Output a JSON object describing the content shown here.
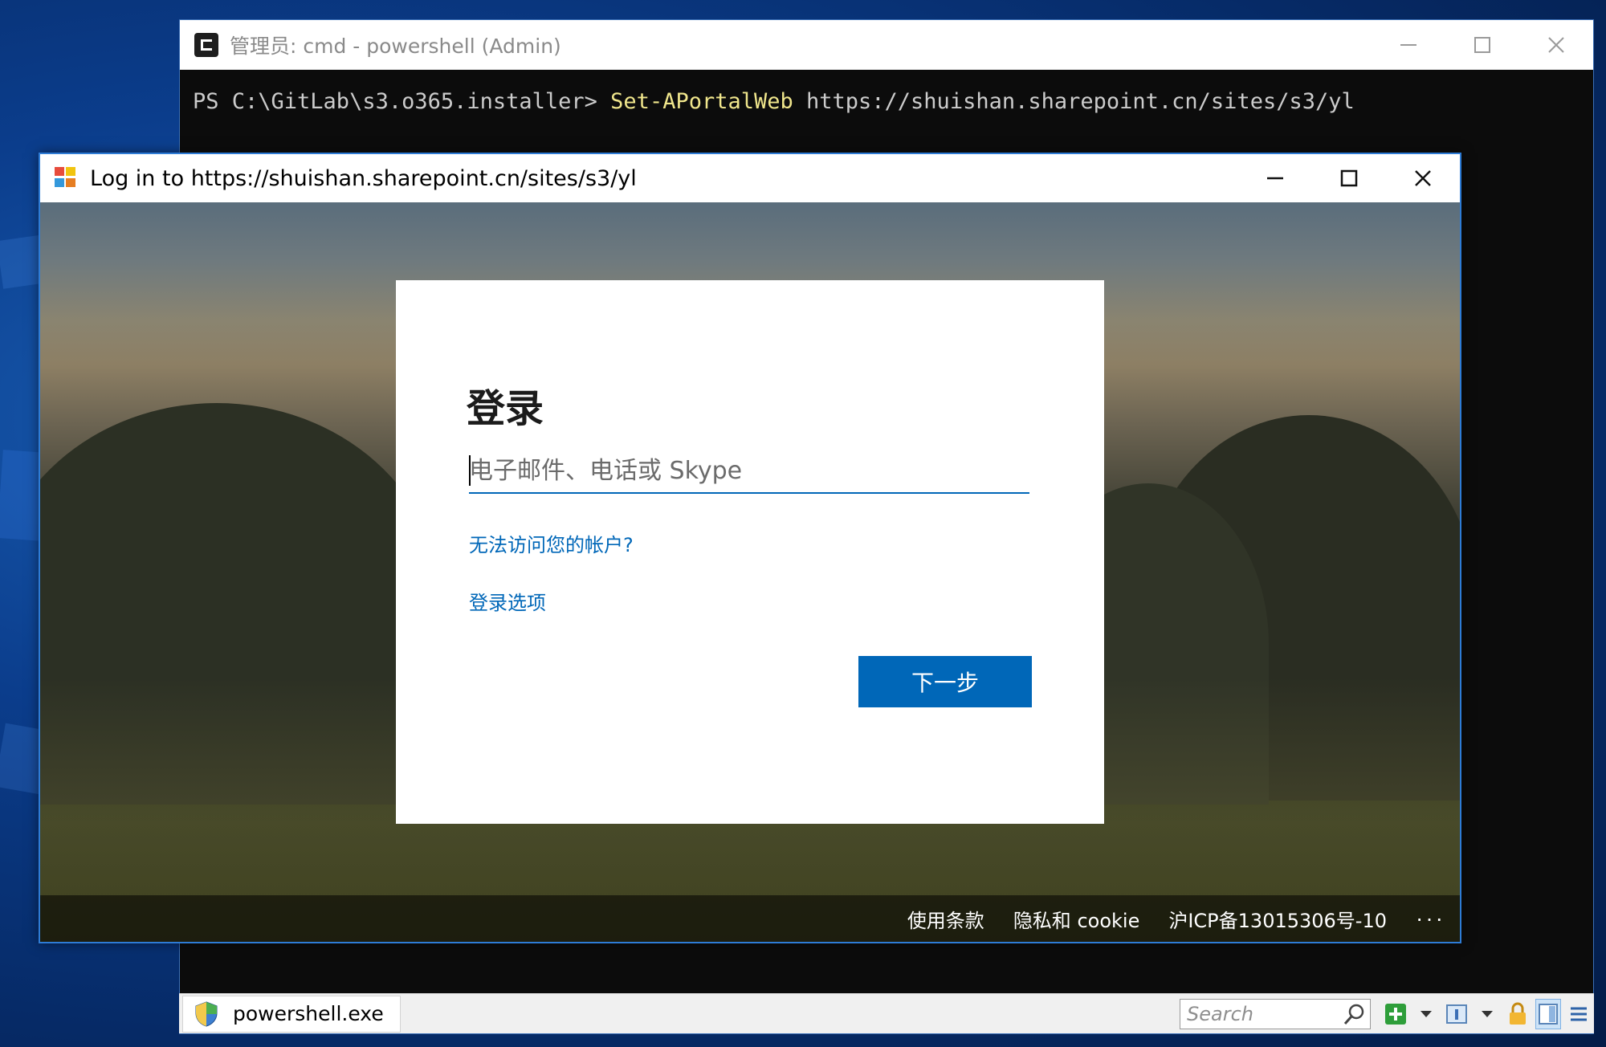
{
  "console": {
    "title": "管理员: cmd - powershell (Admin)",
    "prompt": "PS C:\\GitLab\\s3.o365.installer> ",
    "cmdlet": "Set-APortalWeb",
    "argument": " https://shuishan.sharepoint.cn/sites/s3/yl"
  },
  "login_window": {
    "title": "Log in to https://shuishan.sharepoint.cn/sites/s3/yl",
    "card": {
      "heading": "登录",
      "email_placeholder": "电子邮件、电话或 Skype",
      "cant_access_link": "无法访问您的帐户?",
      "signin_options_link": "登录选项",
      "next_button": "下一步"
    },
    "footer": {
      "terms": "使用条款",
      "privacy": "隐私和 cookie",
      "icp": "沪ICP备13015306号-10",
      "more": "···"
    }
  },
  "status_bar": {
    "process_name": "powershell.exe",
    "search_placeholder": "Search"
  },
  "colors": {
    "accent": "#0067b8",
    "window_border": "#2e7cd6",
    "console_bg": "#0c0c0c",
    "cmdlet": "#f0e68c"
  },
  "icons": [
    "powershell-app-icon",
    "minimize-icon",
    "maximize-icon",
    "close-icon",
    "login-app-icon",
    "uac-shield-icon",
    "search-icon",
    "add-icon",
    "view-icon",
    "lock-icon",
    "panel-icon",
    "menu-icon"
  ]
}
